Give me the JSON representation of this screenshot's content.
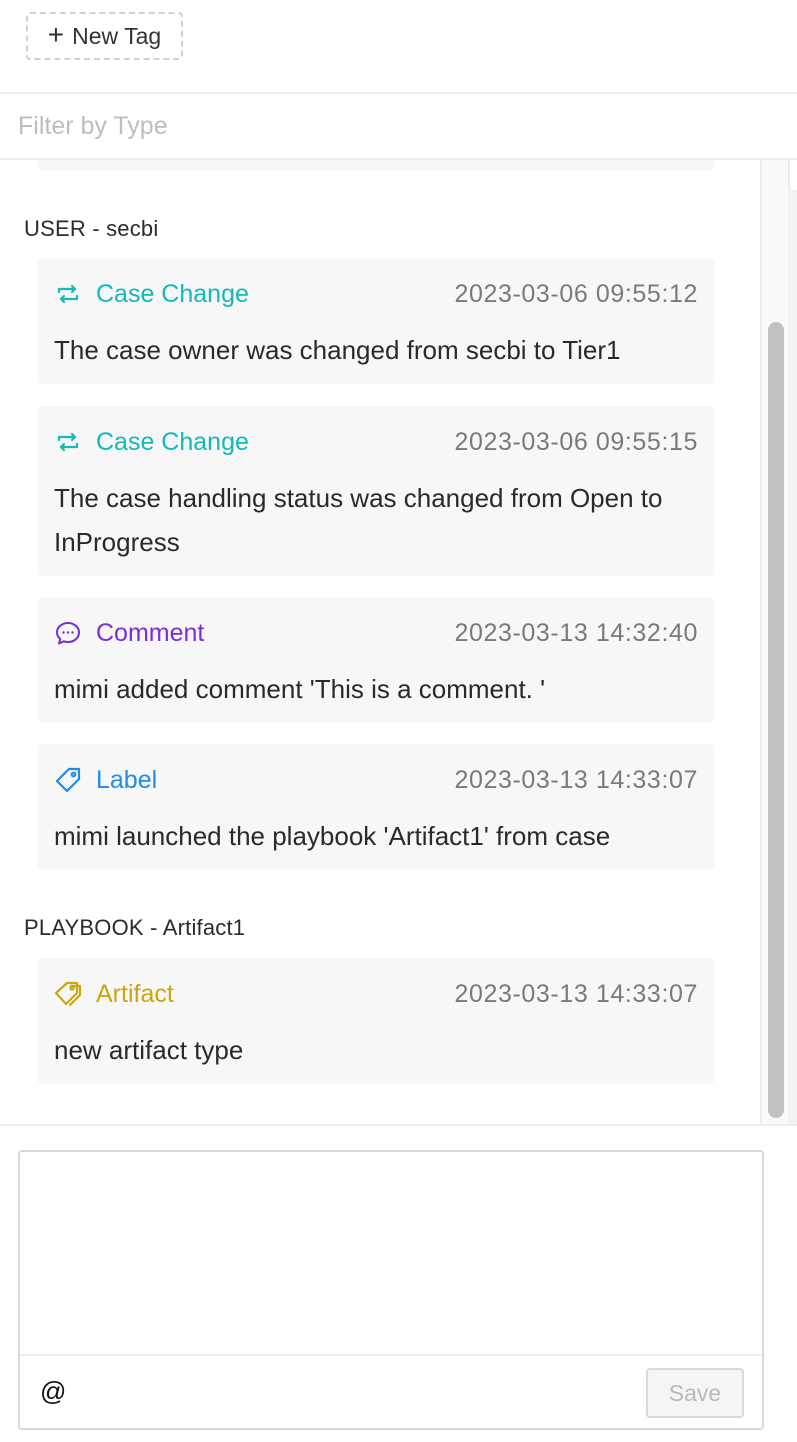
{
  "header": {
    "new_tag_label": "New Tag"
  },
  "filter": {
    "placeholder": "Filter by Type"
  },
  "groups": [
    {
      "title": "USER - secbi",
      "items": [
        {
          "type": "Case Change",
          "icon": "swap-icon",
          "color": "#14b8b9",
          "time": "2023-03-06 09:55:12",
          "text": "The case owner was changed from secbi to Tier1"
        },
        {
          "type": "Case Change",
          "icon": "swap-icon",
          "color": "#14b8b9",
          "time": "2023-03-06 09:55:15",
          "text": "The case handling status was changed from Open to InProgress"
        },
        {
          "type": "Comment",
          "icon": "comment-icon",
          "color": "#7a2fd6",
          "time": "2023-03-13 14:32:40",
          "text": "mimi added comment 'This is a comment. '"
        },
        {
          "type": "Label",
          "icon": "tag-icon",
          "color": "#1f8ceb",
          "time": "2023-03-13 14:33:07",
          "text": "mimi launched the playbook 'Artifact1' from case"
        }
      ]
    },
    {
      "title": "PLAYBOOK - Artifact1",
      "items": [
        {
          "type": "Artifact",
          "icon": "artifact-tag-icon",
          "color": "#c9a80c",
          "time": "2023-03-13 14:33:07",
          "text": "new artifact type"
        }
      ]
    }
  ],
  "editor": {
    "value": "",
    "mention_label": "@",
    "save_label": "Save"
  }
}
